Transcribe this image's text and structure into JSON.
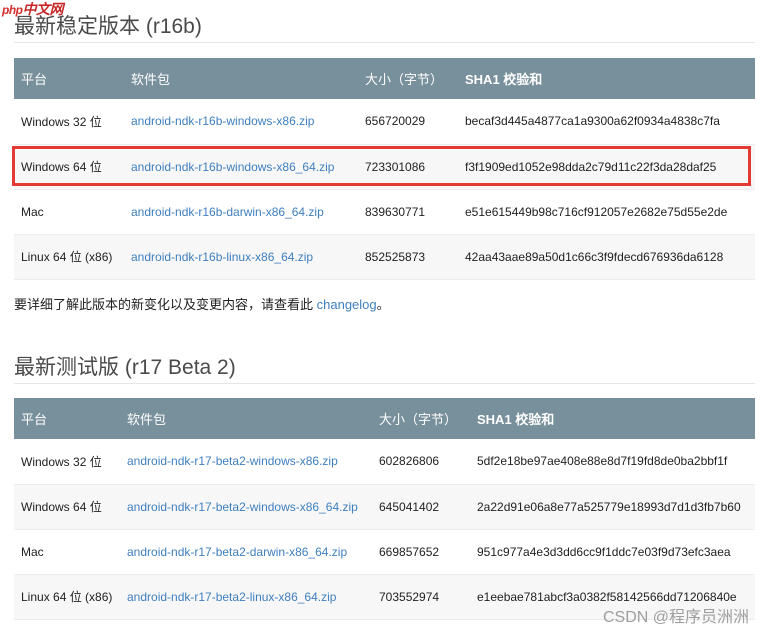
{
  "watermark_top": {
    "php": "php",
    "site": "中文网"
  },
  "stable": {
    "title": "最新稳定版本 (r16b)",
    "headers": [
      "平台",
      "软件包",
      "大小（字节）",
      "SHA1 校验和"
    ],
    "rows": [
      {
        "platform": "Windows 32 位",
        "package": "android-ndk-r16b-windows-x86.zip",
        "size": "656720029",
        "sha1": "becaf3d445a4877ca1a9300a62f0934a4838c7fa"
      },
      {
        "platform": "Windows 64 位",
        "package": "android-ndk-r16b-windows-x86_64.zip",
        "size": "723301086",
        "sha1": "f3f1909ed1052e98dda2c79d11c22f3da28daf25"
      },
      {
        "platform": "Mac",
        "package": "android-ndk-r16b-darwin-x86_64.zip",
        "size": "839630771",
        "sha1": "e51e615449b98c716cf912057e2682e75d55e2de"
      },
      {
        "platform": "Linux 64 位 (x86)",
        "package": "android-ndk-r16b-linux-x86_64.zip",
        "size": "852525873",
        "sha1": "42aa43aae89a50d1c66c3f9fdecd676936da6128"
      }
    ]
  },
  "changelog_note": {
    "text": "要详细了解此版本的新变化以及变更内容，请查看此 ",
    "link": "changelog",
    "suffix": "。"
  },
  "beta": {
    "title": "最新测试版 (r17 Beta 2)",
    "headers": [
      "平台",
      "软件包",
      "大小（字节）",
      "SHA1 校验和"
    ],
    "rows": [
      {
        "platform": "Windows 32 位",
        "package": "android-ndk-r17-beta2-windows-x86.zip",
        "size": "602826806",
        "sha1": "5df2e18be97ae408e88e8d7f19fd8de0ba2bbf1f"
      },
      {
        "platform": "Windows 64 位",
        "package": "android-ndk-r17-beta2-windows-x86_64.zip",
        "size": "645041402",
        "sha1": "2a22d91e06a8e77a525779e18993d7d1d3fb7b60"
      },
      {
        "platform": "Mac",
        "package": "android-ndk-r17-beta2-darwin-x86_64.zip",
        "size": "669857652",
        "sha1": "951c977a4e3d3dd6cc9f1ddc7e03f9d73efc3aea"
      },
      {
        "platform": "Linux 64 位 (x86)",
        "package": "android-ndk-r17-beta2-linux-x86_64.zip",
        "size": "703552974",
        "sha1": "e1eebae781abcf3a0382f58142566dd71206840e"
      }
    ]
  },
  "watermark_bottom": "CSDN @程序员洲洲",
  "colors": {
    "header_bg": "#78909c",
    "link": "#3f7fbf",
    "highlight": "#e53935"
  }
}
